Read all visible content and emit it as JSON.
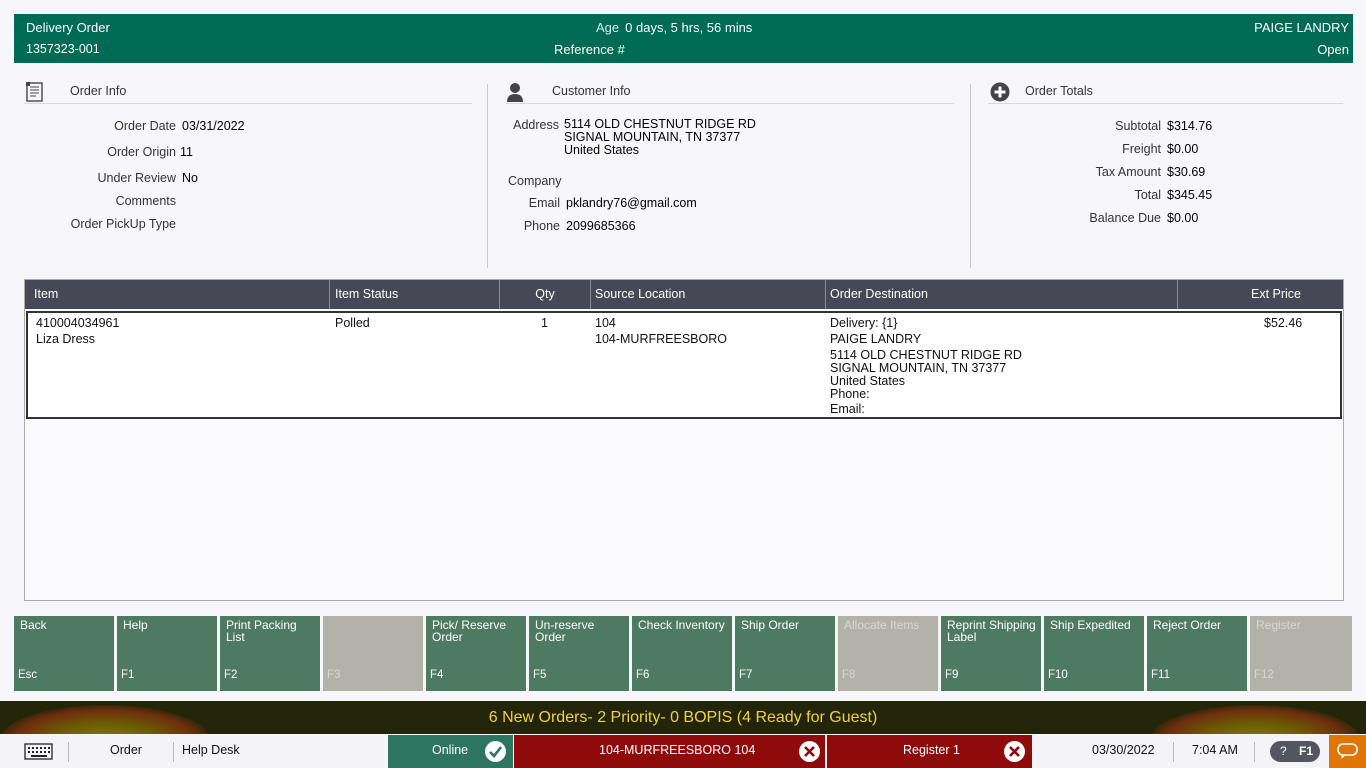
{
  "header": {
    "order_type": "Delivery Order",
    "order_number": "1357323-001",
    "age_label": "Age",
    "age_value": "0 days, 5 hrs, 56 mins",
    "reference_label": "Reference #",
    "customer_name": "PAIGE LANDRY",
    "status": "Open"
  },
  "order_info": {
    "title": "Order Info",
    "order_date_label": "Order Date",
    "order_date": "03/31/2022",
    "order_origin_label": "Order Origin",
    "order_origin": "11",
    "under_review_label": "Under Review",
    "under_review": "No",
    "comments_label": "Comments",
    "pickup_type_label": "Order PickUp Type"
  },
  "customer_info": {
    "title": "Customer Info",
    "address_label": "Address",
    "address_line1": "5114 OLD CHESTNUT RIDGE RD",
    "address_line2": "SIGNAL MOUNTAIN, TN 37377",
    "address_line3": "United States",
    "company_label": "Company",
    "email_label": "Email",
    "email": "pklandry76@gmail.com",
    "phone_label": "Phone",
    "phone": "2099685366"
  },
  "order_totals": {
    "title": "Order Totals",
    "subtotal_label": "Subtotal",
    "subtotal": "$314.76",
    "freight_label": "Freight",
    "freight": "$0.00",
    "tax_label": "Tax Amount",
    "tax": "$30.69",
    "total_label": "Total",
    "total": "$345.45",
    "balance_label": "Balance Due",
    "balance": "$0.00"
  },
  "items_table": {
    "columns": [
      "Item",
      "Item Status",
      "Qty",
      "Source Location",
      "Order Destination",
      "Ext Price"
    ],
    "rows": [
      {
        "item_number": "410004034961",
        "item_name": "Liza Dress",
        "status": "Polled",
        "qty": "1",
        "source_code": "104",
        "source_name": "104-MURFREESBORO",
        "dest_type": "Delivery: {1}",
        "dest_name": "PAIGE LANDRY",
        "dest_line1": "5114 OLD CHESTNUT RIDGE RD",
        "dest_line2": "SIGNAL MOUNTAIN, TN 37377",
        "dest_line3": "United States",
        "dest_phone": "Phone:",
        "dest_email": "Email:",
        "ext_price": "$52.46"
      }
    ]
  },
  "function_keys": [
    {
      "label": "Back",
      "key": "Esc",
      "enabled": true
    },
    {
      "label": "Help",
      "key": "F1",
      "enabled": true
    },
    {
      "label": "Print Packing List",
      "key": "F2",
      "enabled": true
    },
    {
      "label": "",
      "key": "F3",
      "enabled": false
    },
    {
      "label": "Pick/ Reserve Order",
      "key": "F4",
      "enabled": true
    },
    {
      "label": "Un-reserve Order",
      "key": "F5",
      "enabled": true
    },
    {
      "label": "Check Inventory",
      "key": "F6",
      "enabled": true
    },
    {
      "label": "Ship Order",
      "key": "F7",
      "enabled": true
    },
    {
      "label": "Allocate Items",
      "key": "F8",
      "enabled": false
    },
    {
      "label": "Reprint Shipping Label",
      "key": "F9",
      "enabled": true
    },
    {
      "label": "Ship Expedited",
      "key": "F10",
      "enabled": true
    },
    {
      "label": "Reject Order",
      "key": "F11",
      "enabled": true
    },
    {
      "label": "Register",
      "key": "F12",
      "enabled": false
    }
  ],
  "banner": {
    "text": "6 New Orders- 2 Priority- 0 BOPIS (4 Ready for Guest)"
  },
  "status_bar": {
    "order_label": "Order",
    "help_desk_label": "Help Desk",
    "online_label": "Online",
    "store_label": "104-MURFREESBORO 104",
    "register_label": "Register 1",
    "date": "03/30/2022",
    "time": "7:04 AM",
    "help_question": "?",
    "help_key": "F1"
  },
  "colors": {
    "header_green": "#006b55",
    "fkey_green": "#4f7a62",
    "fkey_disabled": "#b3b2a9",
    "error_red": "#8f0a0a",
    "banner_text": "#f0d23a",
    "accent_orange": "#e07500"
  }
}
